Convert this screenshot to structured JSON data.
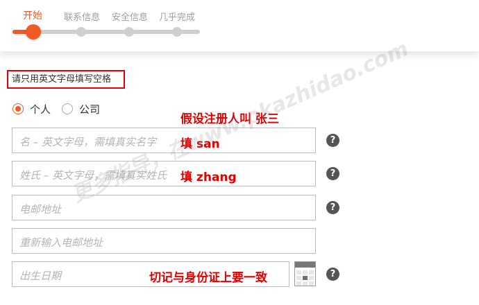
{
  "progress": {
    "steps": [
      "开始",
      "联系信息",
      "安全信息",
      "几乎完成"
    ],
    "active_step": 0,
    "accent_color": "#f15a24"
  },
  "notice": "请只用英文字母填写空格",
  "account_type": {
    "options": [
      "个人",
      "公司"
    ],
    "selected": "个人"
  },
  "fields": {
    "first_name_placeholder": "名 – 英文字母，需填真实名字",
    "last_name_placeholder": "姓氏 – 英文字母，需填真实姓氏",
    "email_placeholder": "电邮地址",
    "email_confirm_placeholder": "重新输入电邮地址",
    "dob_placeholder": "出生日期"
  },
  "help_symbol": "?",
  "annotations": {
    "assume": "假设注册人叫 张三",
    "first_name": "填 san",
    "last_name": "填 zhang",
    "dob": "切记与身份证上要一致"
  },
  "watermark": "更多指导，在www.pkazhidao.com",
  "icons": [
    "help-icon",
    "calendar-icon"
  ]
}
